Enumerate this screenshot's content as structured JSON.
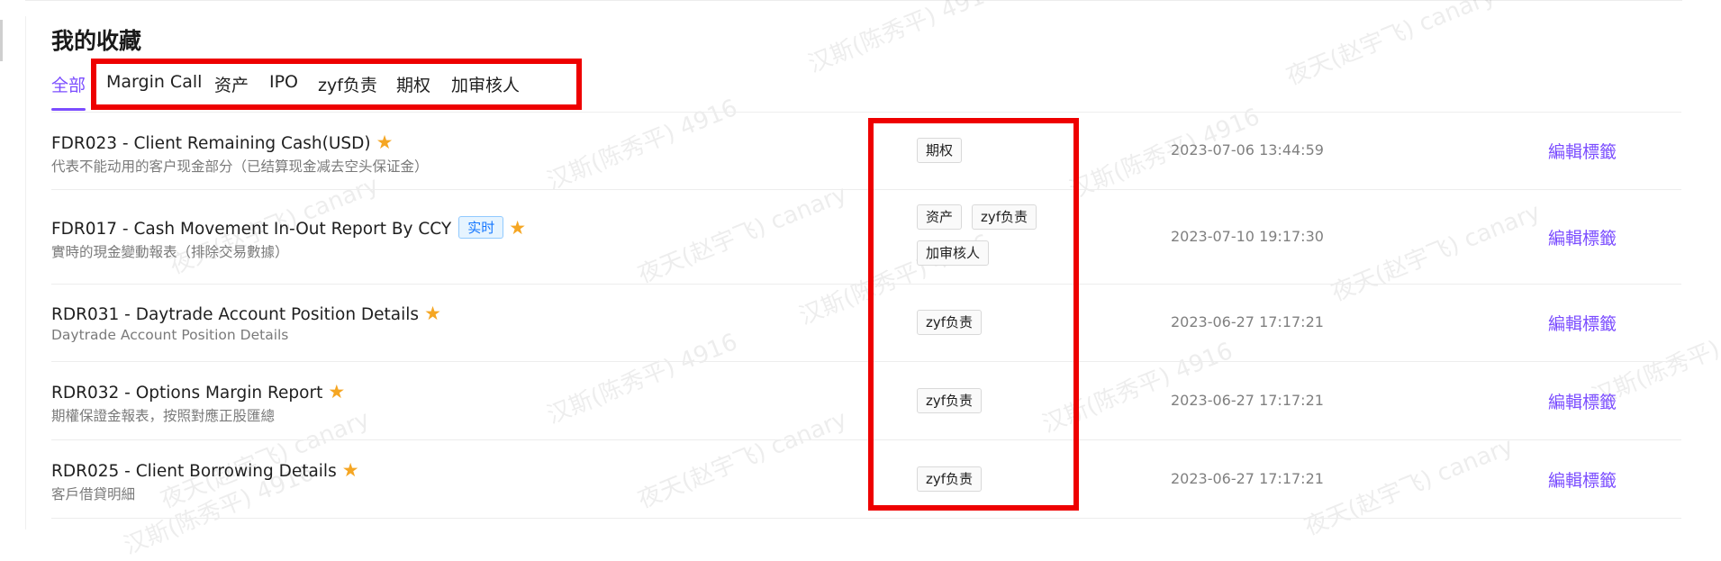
{
  "page": {
    "title": "我的收藏",
    "accent_color": "#7b4dff",
    "star_color": "#f5a623",
    "highlight_color": "#ee0000"
  },
  "tabs": [
    {
      "label": "全部",
      "active": true
    },
    {
      "label": "Margin Call",
      "active": false
    },
    {
      "label": "资产",
      "active": false
    },
    {
      "label": "IPO",
      "active": false
    },
    {
      "label": "zyf负责",
      "active": false
    },
    {
      "label": "期权",
      "active": false
    },
    {
      "label": "加审核人",
      "active": false
    }
  ],
  "rows": [
    {
      "title": "FDR023 - Client Remaining Cash(USD)",
      "description": "代表不能动用的客户现金部分（已结算现金减去空头保证金）",
      "favorited": true,
      "badge": null,
      "tags": [
        "期权"
      ],
      "date": "2023-07-06 13:44:59",
      "action": "編輯標籤"
    },
    {
      "title": "FDR017 - Cash Movement In-Out Report By CCY",
      "description": "實時的現金變動報表（排除交易數據）",
      "favorited": true,
      "badge": "实时",
      "tags": [
        "资产",
        "zyf负责",
        "加审核人"
      ],
      "date": "2023-07-10 19:17:30",
      "action": "編輯標籤"
    },
    {
      "title": "RDR031 - Daytrade Account Position Details",
      "description": "Daytrade Account Position Details",
      "favorited": true,
      "badge": null,
      "tags": [
        "zyf负责"
      ],
      "date": "2023-06-27 17:17:21",
      "action": "編輯標籤"
    },
    {
      "title": "RDR032 - Options Margin Report",
      "description": "期權保證金報表，按照對應正股匯總",
      "favorited": true,
      "badge": null,
      "tags": [
        "zyf负责"
      ],
      "date": "2023-06-27 17:17:21",
      "action": "編輯標籤"
    },
    {
      "title": "RDR025 - Client Borrowing Details",
      "description": "客戶借貸明細",
      "favorited": true,
      "badge": null,
      "tags": [
        "zyf负责"
      ],
      "date": "2023-06-27 17:17:21",
      "action": "編輯標籤"
    }
  ],
  "watermark": {
    "texts": [
      "汉斯(陈秀平) 4916",
      "夜天(赵宇飞) canary"
    ]
  }
}
